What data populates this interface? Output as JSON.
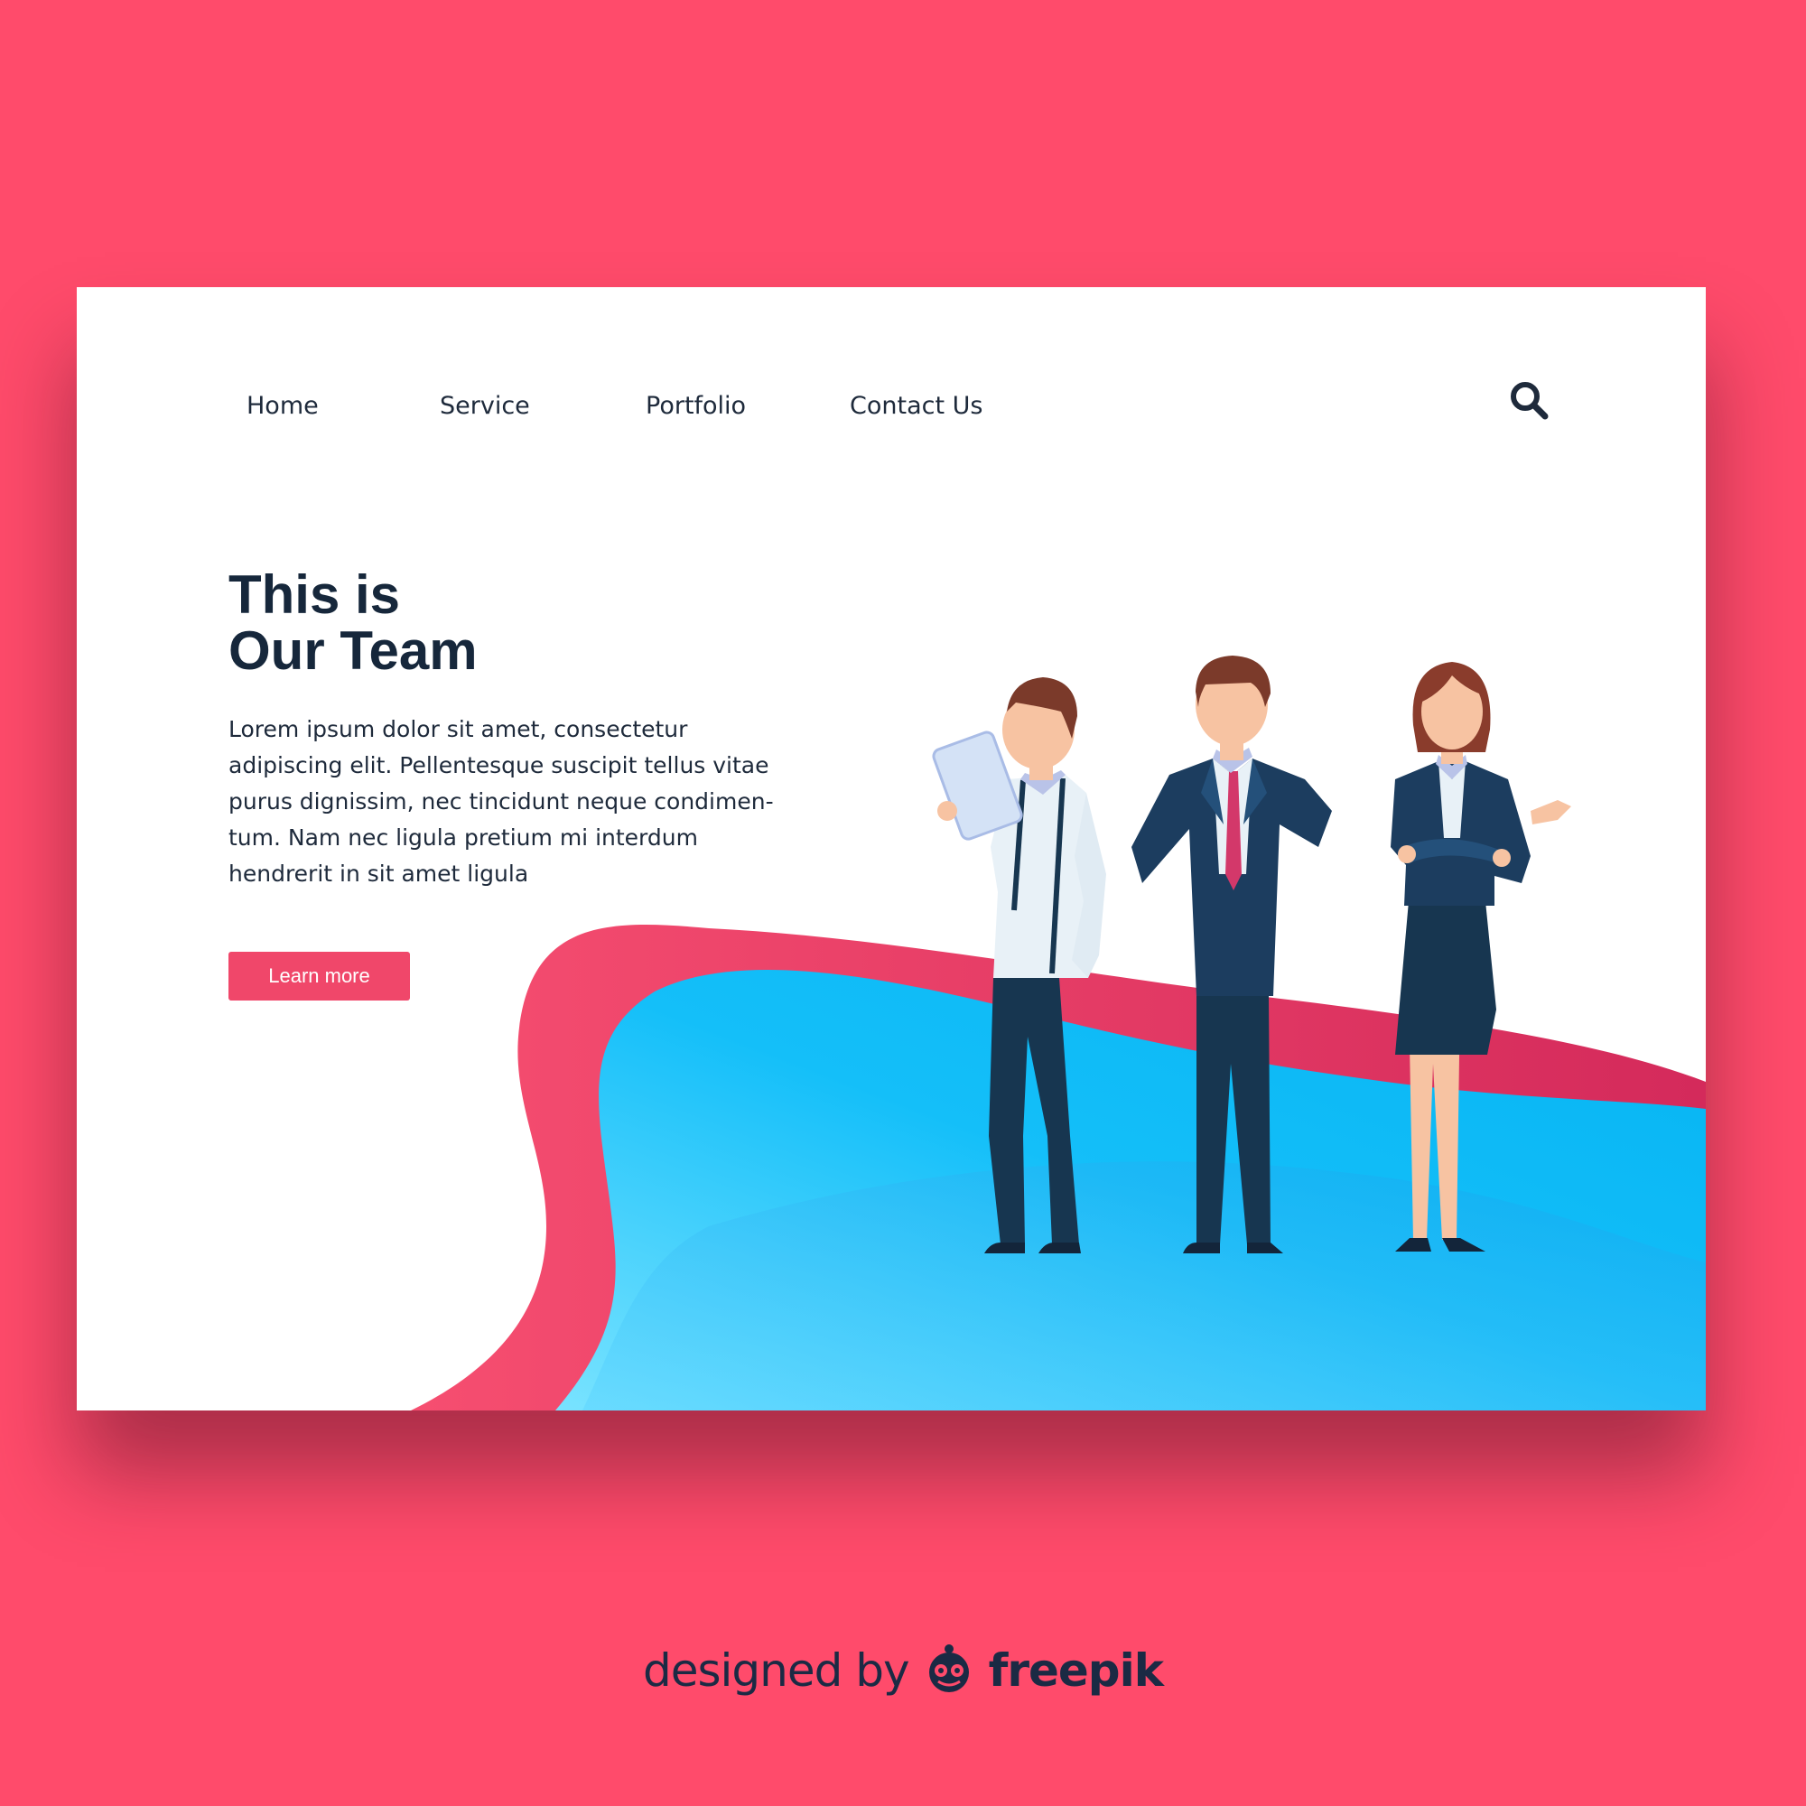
{
  "nav": {
    "items": [
      {
        "label": "Home"
      },
      {
        "label": "Service"
      },
      {
        "label": "Portfolio"
      },
      {
        "label": "Contact Us"
      }
    ],
    "search_icon": "search-icon"
  },
  "hero": {
    "title_line1": "This is",
    "title_line2": "Our Team",
    "body": "Lorem ipsum dolor sit amet, consectetur adipiscing elit. Pellentesque suscipit tellus vitae purus dignissim, nec tincidunt neque condimen- tum. Nam nec ligula pretium mi interdum hendrerit in sit amet ligula",
    "cta_label": "Learn more"
  },
  "illustration": {
    "figures": [
      "man-with-tablet",
      "man-in-suit",
      "woman-in-suit"
    ]
  },
  "credit": {
    "lead": "designed by",
    "brand": "freepik",
    "logo_icon": "freepik-logo-icon"
  },
  "colors": {
    "background": "#ff4b6b",
    "accent": "#f0476a",
    "text_dark": "#16273b",
    "wave_blue": "#1cc3fb",
    "suit_navy": "#1c3d5f"
  }
}
